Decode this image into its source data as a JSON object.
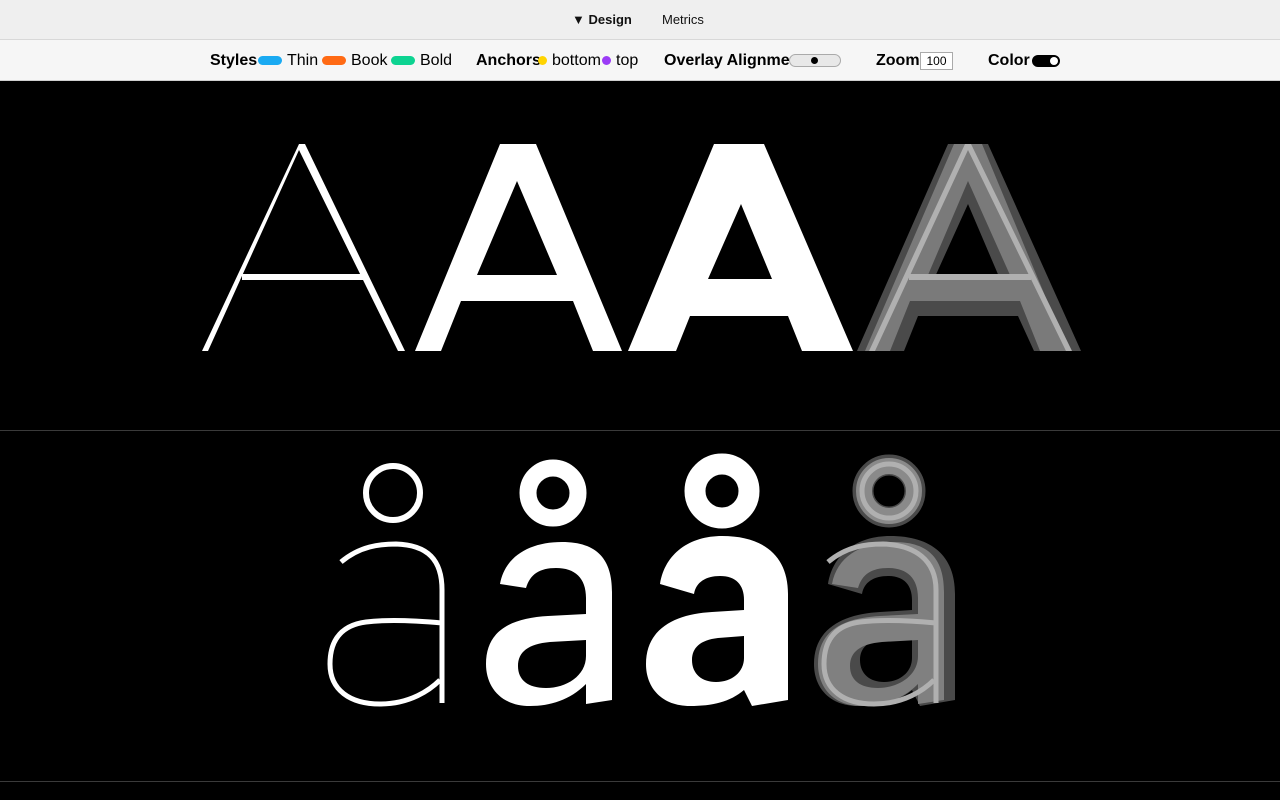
{
  "header": {
    "tabs": [
      {
        "label": "▼ Design"
      },
      {
        "label": "Metrics"
      }
    ]
  },
  "toolbar": {
    "styles_label": "Styles",
    "styles": [
      {
        "name": "Thin",
        "color": "#1aaaf2"
      },
      {
        "name": "Book",
        "color": "#ff6a14"
      },
      {
        "name": "Bold",
        "color": "#0dd391"
      }
    ],
    "anchors_label": "Anchors",
    "anchors": [
      {
        "name": "bottom",
        "color": "#ffd400"
      },
      {
        "name": "top",
        "color": "#9b3cf6"
      }
    ],
    "overlay_label": "Overlay Alignment",
    "zoom_label": "Zoom",
    "zoom_value": "100",
    "color_label": "Color",
    "color_toggle_on": true
  },
  "canvas": {
    "rows": [
      {
        "glyph": "A",
        "variants": [
          "Thin",
          "Book",
          "Bold",
          "Overlay"
        ]
      },
      {
        "glyph": "å",
        "variants": [
          "Thin",
          "Book",
          "Bold",
          "Overlay"
        ]
      }
    ]
  }
}
